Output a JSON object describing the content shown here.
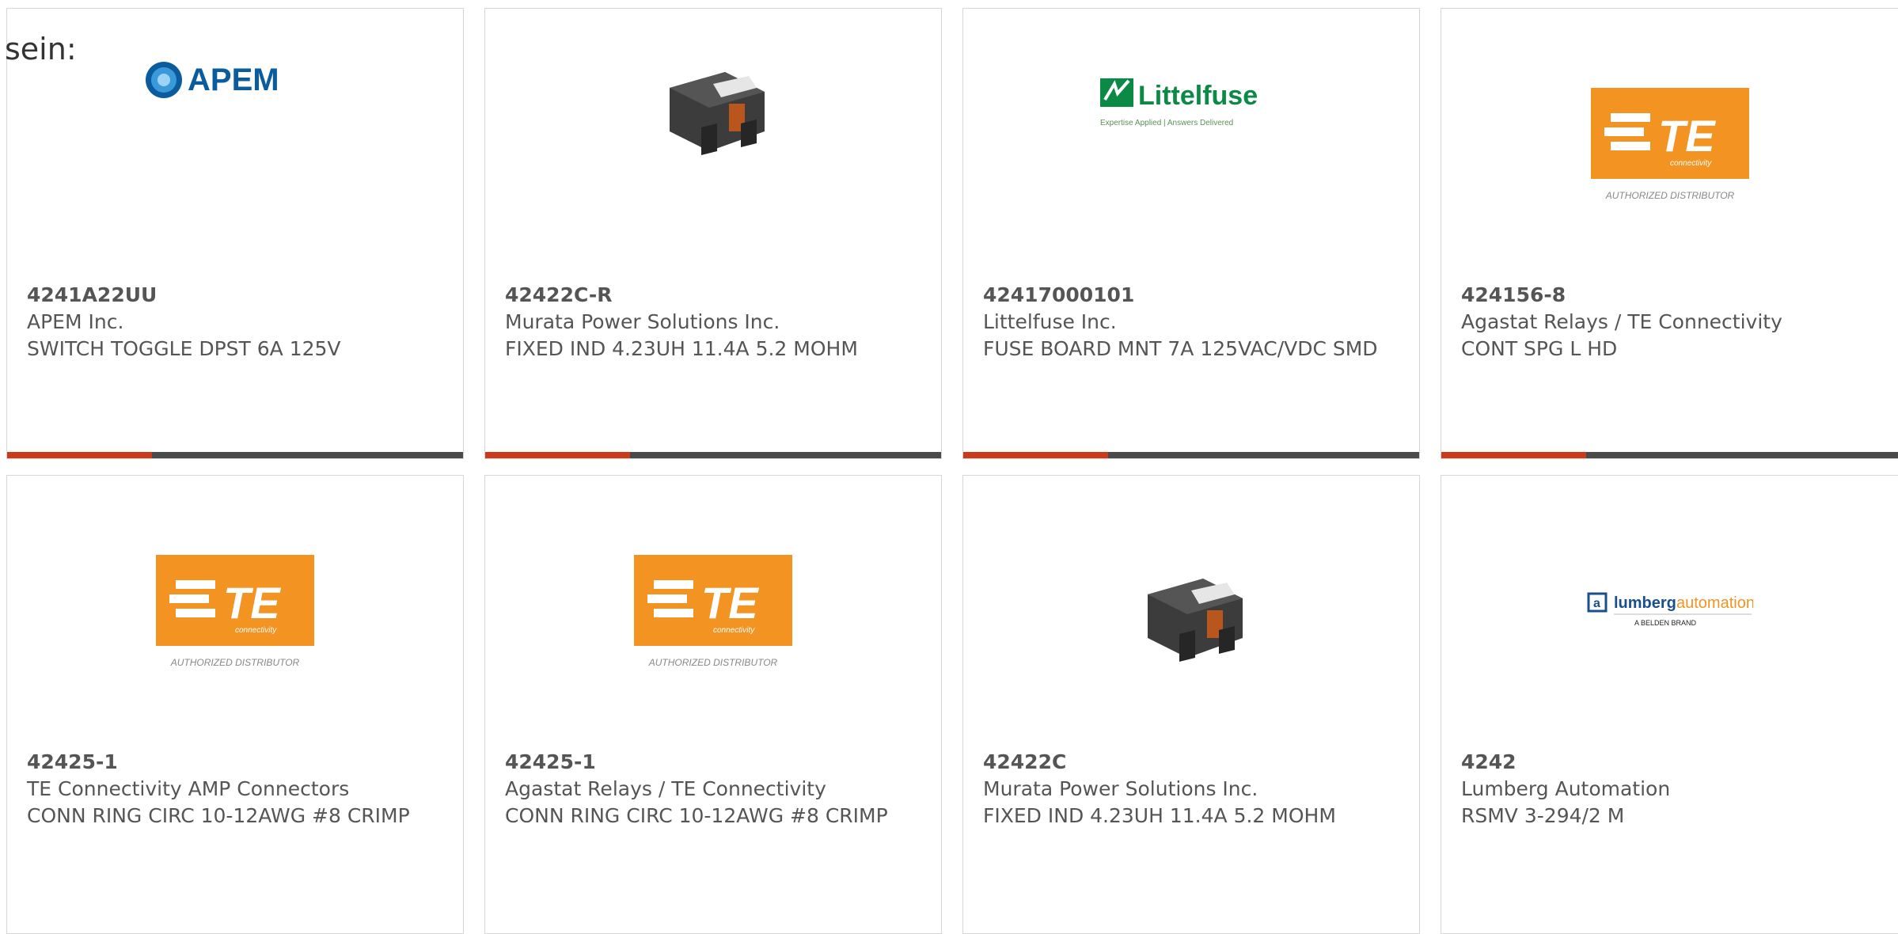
{
  "intro_text": "sein:",
  "products": [
    {
      "part": "4241A22UU",
      "maker": "APEM Inc.",
      "desc": "SWITCH TOGGLE DPST 6A 125V",
      "image": "apem-logo"
    },
    {
      "part": "42422C-R",
      "maker": "Murata Power Solutions Inc.",
      "desc": "FIXED IND 4.23UH 11.4A 5.2 MOHM",
      "image": "inductor-photo"
    },
    {
      "part": "42417000101",
      "maker": "Littelfuse Inc.",
      "desc": "FUSE BOARD MNT 7A 125VAC/VDC SMD",
      "image": "littelfuse-logo"
    },
    {
      "part": "424156-8",
      "maker": "Agastat Relays / TE Connectivity",
      "desc": "CONT SPG L HD",
      "image": "te-logo"
    },
    {
      "part": "42425-1",
      "maker": "TE Connectivity AMP Connectors",
      "desc": "CONN RING CIRC 10-12AWG #8 CRIMP",
      "image": "te-logo"
    },
    {
      "part": "42425-1",
      "maker": "Agastat Relays / TE Connectivity",
      "desc": "CONN RING CIRC 10-12AWG #8 CRIMP",
      "image": "te-logo"
    },
    {
      "part": "42422C",
      "maker": "Murata Power Solutions Inc.",
      "desc": "FIXED IND 4.23UH 11.4A 5.2 MOHM",
      "image": "inductor-photo"
    },
    {
      "part": "4242",
      "maker": "Lumberg Automation",
      "desc": "RSMV 3-294/2 M",
      "image": "lumberg-logo"
    }
  ],
  "logos": {
    "apem": "APEM",
    "littelfuse": "Littelfuse",
    "littelfuse_tagline": "Expertise Applied | Answers Delivered",
    "te": "TE",
    "te_sub": "connectivity",
    "te_caption": "AUTHORIZED DISTRIBUTOR",
    "lumberg_a": "lumberg",
    "lumberg_b": "automation",
    "lumberg_sub": "A BELDEN BRAND"
  },
  "colors": {
    "accent": "#cc3a1a",
    "bar": "#4a4a4a",
    "te_orange": "#f39322",
    "littelfuse_green": "#0b8a45",
    "apem_blue": "#0a5c9e"
  }
}
